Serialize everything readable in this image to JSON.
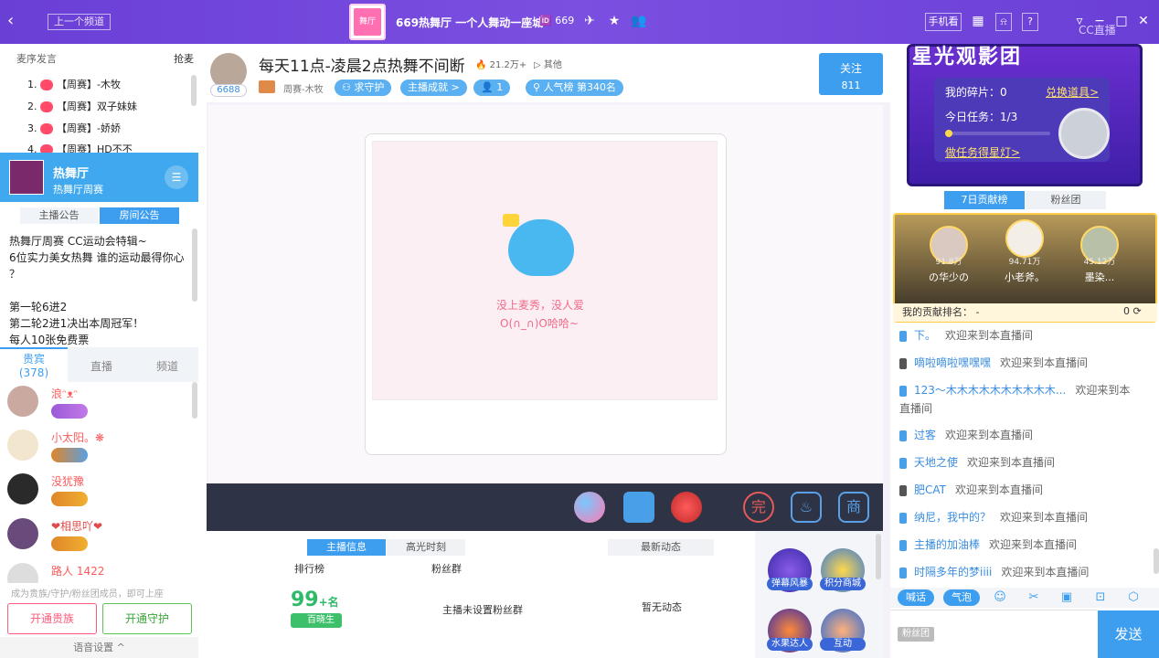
{
  "titlebar": {
    "prev_channel": "上一个频道",
    "logo_text": "舞厅",
    "room_name": "669热舞厅 一个人舞动一座城",
    "room_id": "669",
    "phone_watch": "手机看",
    "brand": "CC直播"
  },
  "left": {
    "seat_head": "麦序发言",
    "grab_seat": "抢麦",
    "rank_list": [
      {
        "rank": "1.",
        "name": "【周赛】-木牧"
      },
      {
        "rank": "2.",
        "name": "【周赛】双子妹妹"
      },
      {
        "rank": "3.",
        "name": "【周赛】-娇娇"
      },
      {
        "rank": "4.",
        "name": "【周赛】HD不不"
      }
    ],
    "hall": {
      "name": "热舞厅",
      "sub": "热舞厅周赛"
    },
    "notice_tabs": [
      "主播公告",
      "房间公告"
    ],
    "notice_lines": [
      "热舞厅周赛 CC运动会特辑~",
      "6位实力美女热舞 谁的运动最得你心",
      "？",
      "",
      "第一轮6进2",
      "第二轮2进1决出本周冠军！",
      "每人10张免费票"
    ],
    "tabs": {
      "vip": "贵宾",
      "vip_count": "(378)",
      "live": "直播",
      "channel": "频道"
    },
    "members": [
      {
        "name": "浪ᵔᴥᵔ"
      },
      {
        "name": "小太阳。❋"
      },
      {
        "name": "没犹豫"
      },
      {
        "name": "❤相思吖❤"
      },
      {
        "name": "路人 1422"
      }
    ],
    "join_tip": "成为贵族/守护/粉丝团成员，即可上座",
    "btn_noble": "开通贵族",
    "btn_guard": "开通守护",
    "voice_settings": "语音设置 ^"
  },
  "main": {
    "fan_count": "6688",
    "title": "每天11点-凌晨2点热舞不间断",
    "hot": "21.2万+",
    "other": "其他",
    "meta": "周赛-木牧",
    "chips": [
      "求守护",
      "主播成就 >",
      "1",
      "人气榜 第340名"
    ],
    "follow_label": "关注",
    "follow_count": "811",
    "empty_line1": "没上麦秀，没人爱",
    "empty_line2": "O(∩_∩)O哈哈~",
    "info_tabs": [
      "主播信息",
      "高光时刻",
      "最新动态"
    ],
    "rank_label": "排行榜",
    "fan_label": "粉丝群",
    "rank_value": "99",
    "rank_suffix": "+名",
    "rank_tag": "百晓生",
    "no_fan_group": "主播未设置粉丝群",
    "no_dynamic": "暂无动态",
    "side_buttons": [
      "弹幕风暴",
      "积分商城",
      "水果达人",
      "互动"
    ]
  },
  "right": {
    "banner_title": "星光观影团",
    "shards_label": "我的碎片：0",
    "exchange_link": "兑换道具>",
    "task_label": "今日任务：1/3",
    "task_link": "做任务得星灯>",
    "tabs": [
      "7日贡献榜",
      "粉丝团"
    ],
    "podium": [
      {
        "score": "91.8万",
        "name": "の华少の"
      },
      {
        "score": "94.71万",
        "name": "小老斧。"
      },
      {
        "score": "45.12万",
        "name": "墨染..."
      }
    ],
    "my_rank_label": "我的贡献排名：  -",
    "my_rank_value": "0",
    "welcome": "欢迎来到本直播间",
    "chat": [
      {
        "user": "下。"
      },
      {
        "user": "嘀啦嘀啦嘿嘿嘿"
      },
      {
        "user": "123～木木木木木木木木木木..."
      },
      {
        "user": "过客"
      },
      {
        "user": "天地之使"
      },
      {
        "user": "肥CAT"
      },
      {
        "user": "纳尼，我中的？"
      },
      {
        "user": "主播的加油棒"
      },
      {
        "user": "时隔多年的梦iiii"
      }
    ],
    "chat_btns": [
      "喊话",
      "气泡"
    ],
    "fan_chip": "粉丝团",
    "send": "发送"
  }
}
